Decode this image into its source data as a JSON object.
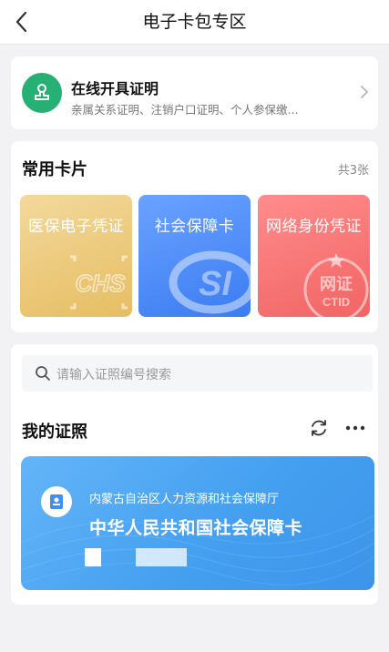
{
  "header": {
    "title": "电子卡包专区"
  },
  "certificate_service": {
    "title": "在线开具证明",
    "subtitle": "亲属关系证明、注销户口证明、个人参保缴..."
  },
  "common_cards": {
    "title": "常用卡片",
    "count": "共3张",
    "cards": [
      {
        "label": "医保电子凭证",
        "watermark": "CHS"
      },
      {
        "label": "社会保障卡",
        "watermark": "SI"
      },
      {
        "label": "网络身份凭证",
        "watermark_top": "网证",
        "watermark_bottom": "CTID"
      }
    ]
  },
  "my_certificates": {
    "search_placeholder": "请输入证照编号搜索",
    "title": "我的证照",
    "social_security_card": {
      "issuer": "内蒙古自治区人力资源和社会保障厅",
      "name": "中华人民共和国社会保障卡"
    }
  },
  "colors": {
    "accent_green": "#26b074",
    "card_blue": "#4a9ff0",
    "card_gold": "#e6bd62",
    "card_red": "#f26464"
  }
}
